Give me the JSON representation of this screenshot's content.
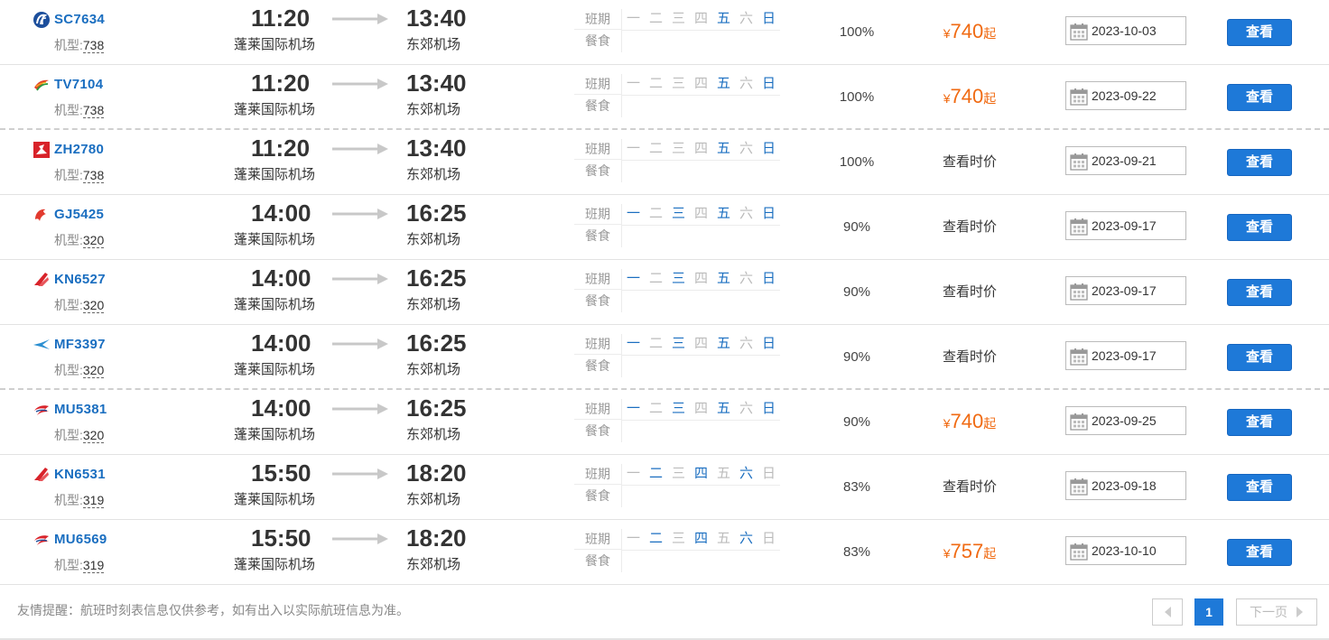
{
  "labels": {
    "model_prefix": "机型:",
    "schedule": "班期",
    "meal": "餐食",
    "weekdays": [
      "一",
      "二",
      "三",
      "四",
      "五",
      "六",
      "日"
    ],
    "currency": "¥",
    "price_suffix": "起",
    "view_price": "查看时价",
    "view_button": "查看"
  },
  "colors": {
    "link_blue": "#1a6ec0",
    "button_blue": "#1e79d8",
    "price_orange": "#f06a12",
    "inactive_day": "#bbbbbb"
  },
  "flights": [
    {
      "code": "SC7634",
      "airline_icon": "shandong-airlines-logo",
      "model": "738",
      "dep_time": "11:20",
      "arr_time": "13:40",
      "dep_airport": "蓬莱国际机场",
      "arr_airport": "东郊机场",
      "days": [
        false,
        false,
        false,
        false,
        true,
        false,
        true
      ],
      "rate": "100%",
      "price": "740",
      "date": "2023-10-03"
    },
    {
      "code": "TV7104",
      "airline_icon": "tibet-airlines-logo",
      "model": "738",
      "dep_time": "11:20",
      "arr_time": "13:40",
      "dep_airport": "蓬莱国际机场",
      "arr_airport": "东郊机场",
      "days": [
        false,
        false,
        false,
        false,
        true,
        false,
        true
      ],
      "rate": "100%",
      "price": "740",
      "date": "2023-09-22"
    },
    {
      "code": "ZH2780",
      "airline_icon": "shenzhen-airlines-logo",
      "model": "738",
      "dep_time": "11:20",
      "arr_time": "13:40",
      "dep_airport": "蓬莱国际机场",
      "arr_airport": "东郊机场",
      "days": [
        false,
        false,
        false,
        false,
        true,
        false,
        true
      ],
      "rate": "100%",
      "price": null,
      "date": "2023-09-21"
    },
    {
      "code": "GJ5425",
      "airline_icon": "loong-air-logo",
      "model": "320",
      "dep_time": "14:00",
      "arr_time": "16:25",
      "dep_airport": "蓬莱国际机场",
      "arr_airport": "东郊机场",
      "days": [
        true,
        false,
        true,
        false,
        true,
        false,
        true
      ],
      "rate": "90%",
      "price": null,
      "date": "2023-09-17"
    },
    {
      "code": "KN6527",
      "airline_icon": "china-united-airlines-logo",
      "model": "320",
      "dep_time": "14:00",
      "arr_time": "16:25",
      "dep_airport": "蓬莱国际机场",
      "arr_airport": "东郊机场",
      "days": [
        true,
        false,
        true,
        false,
        true,
        false,
        true
      ],
      "rate": "90%",
      "price": null,
      "date": "2023-09-17"
    },
    {
      "code": "MF3397",
      "airline_icon": "xiamen-airlines-logo",
      "model": "320",
      "dep_time": "14:00",
      "arr_time": "16:25",
      "dep_airport": "蓬莱国际机场",
      "arr_airport": "东郊机场",
      "days": [
        true,
        false,
        true,
        false,
        true,
        false,
        true
      ],
      "rate": "90%",
      "price": null,
      "date": "2023-09-17"
    },
    {
      "code": "MU5381",
      "airline_icon": "china-eastern-logo",
      "model": "320",
      "dep_time": "14:00",
      "arr_time": "16:25",
      "dep_airport": "蓬莱国际机场",
      "arr_airport": "东郊机场",
      "days": [
        true,
        false,
        true,
        false,
        true,
        false,
        true
      ],
      "rate": "90%",
      "price": "740",
      "date": "2023-09-25"
    },
    {
      "code": "KN6531",
      "airline_icon": "china-united-airlines-logo",
      "model": "319",
      "dep_time": "15:50",
      "arr_time": "18:20",
      "dep_airport": "蓬莱国际机场",
      "arr_airport": "东郊机场",
      "days": [
        false,
        true,
        false,
        true,
        false,
        true,
        false
      ],
      "rate": "83%",
      "price": null,
      "date": "2023-09-18"
    },
    {
      "code": "MU6569",
      "airline_icon": "china-eastern-logo",
      "model": "319",
      "dep_time": "15:50",
      "arr_time": "18:20",
      "dep_airport": "蓬莱国际机场",
      "arr_airport": "东郊机场",
      "days": [
        false,
        true,
        false,
        true,
        false,
        true,
        false
      ],
      "rate": "83%",
      "price": "757",
      "date": "2023-10-10"
    }
  ],
  "footer": {
    "notice": "友情提醒：航班时刻表信息仅供参考，如有出入以实际航班信息为准。",
    "current_page": "1",
    "next_label": "下一页"
  }
}
